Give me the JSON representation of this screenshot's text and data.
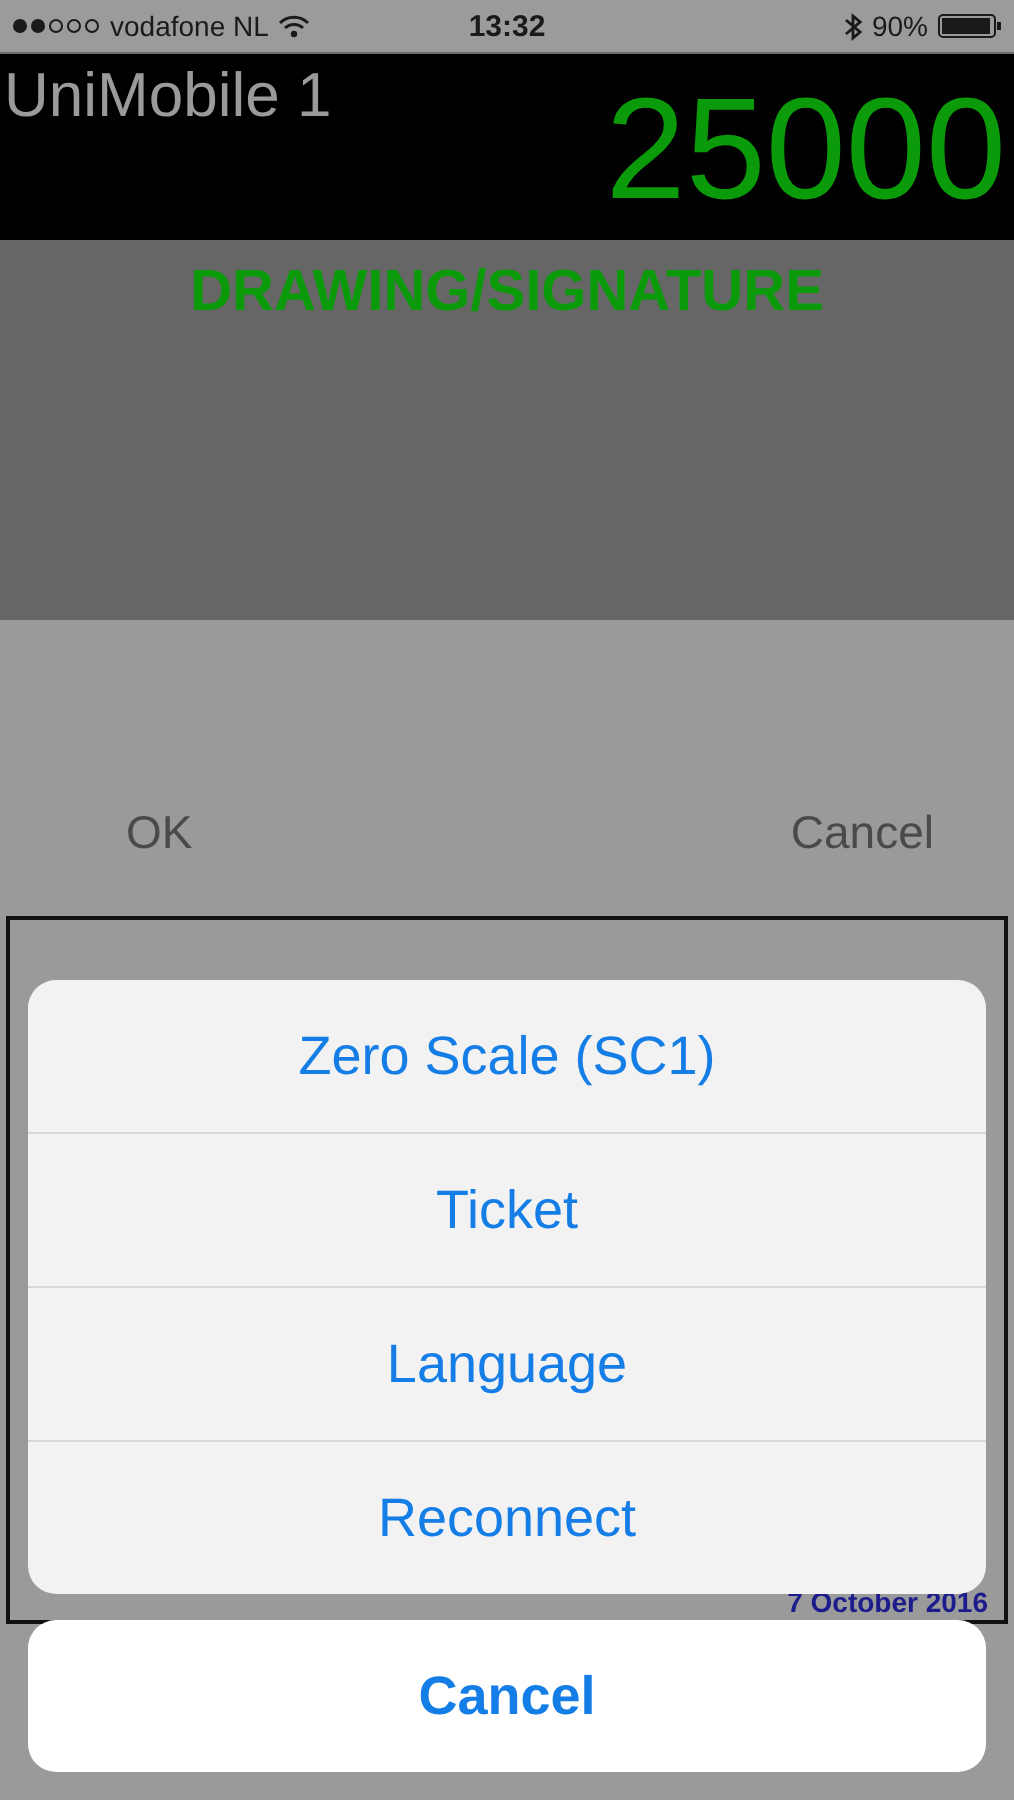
{
  "status_bar": {
    "carrier": "vodafone NL",
    "time": "13:32",
    "battery": "90%"
  },
  "header": {
    "title": "UniMobile 1",
    "weight": "25000"
  },
  "signature": {
    "title": "DRAWING/SIGNATURE",
    "buttons": [
      "OK",
      "Cancel"
    ],
    "date": "7 October 2016"
  },
  "action_sheet": {
    "actions": [
      "Zero Scale (SC1)",
      "Ticket",
      "Language",
      "Reconnect"
    ],
    "cancel": "Cancel"
  }
}
